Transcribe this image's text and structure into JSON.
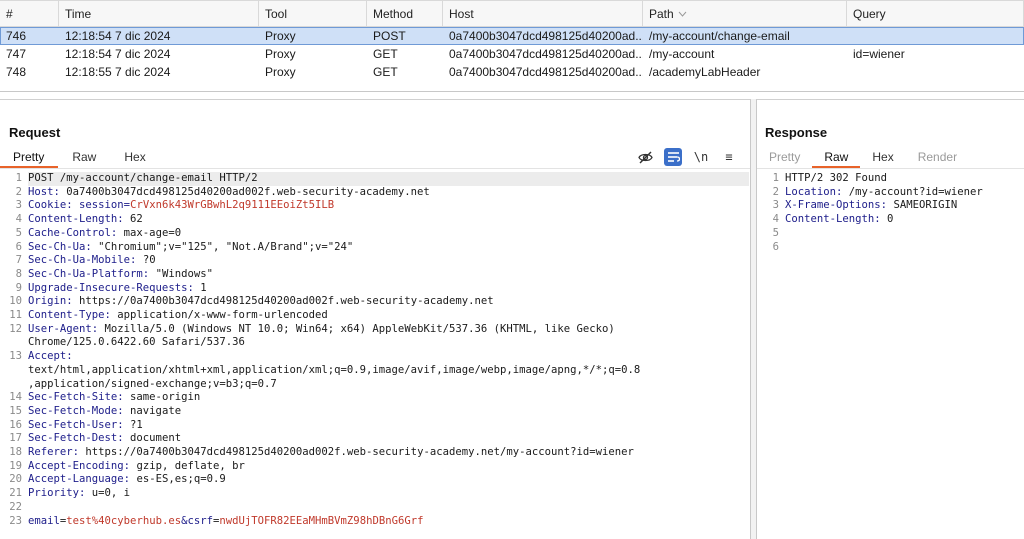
{
  "history": {
    "columns": [
      "#",
      "Time",
      "Tool",
      "Method",
      "Host",
      "Path",
      "Query"
    ],
    "rows": [
      {
        "num": "746",
        "time": "12:18:54 7 dic 2024",
        "tool": "Proxy",
        "method": "POST",
        "host": "0a7400b3047dcd498125d40200ad...",
        "path": "/my-account/change-email",
        "query": ""
      },
      {
        "num": "747",
        "time": "12:18:54 7 dic 2024",
        "tool": "Proxy",
        "method": "GET",
        "host": "0a7400b3047dcd498125d40200ad...",
        "path": "/my-account",
        "query": "id=wiener"
      },
      {
        "num": "748",
        "time": "12:18:55 7 dic 2024",
        "tool": "Proxy",
        "method": "GET",
        "host": "0a7400b3047dcd498125d40200ad...",
        "path": "/academyLabHeader",
        "query": ""
      }
    ]
  },
  "request": {
    "title": "Request",
    "tabs": [
      "Pretty",
      "Raw",
      "Hex"
    ],
    "toolbar": {
      "wrap": "\\n",
      "menu": "≡"
    },
    "lines": [
      {
        "n": "1",
        "plain": "POST /my-account/change-email HTTP/2"
      },
      {
        "n": "2",
        "key": "Host:",
        "val": " 0a7400b3047dcd498125d40200ad002f.web-security-academy.net"
      },
      {
        "n": "3",
        "key": "Cookie:",
        "cname": " session=",
        "cval": "CrVxn6k43WrGBwhL2q9111EEoiZt5ILB"
      },
      {
        "n": "4",
        "key": "Content-Length:",
        "val": " 62"
      },
      {
        "n": "5",
        "key": "Cache-Control:",
        "val": " max-age=0"
      },
      {
        "n": "6",
        "key": "Sec-Ch-Ua:",
        "val": " \"Chromium\";v=\"125\", \"Not.A/Brand\";v=\"24\""
      },
      {
        "n": "7",
        "key": "Sec-Ch-Ua-Mobile:",
        "val": " ?0"
      },
      {
        "n": "8",
        "key": "Sec-Ch-Ua-Platform:",
        "val": " \"Windows\""
      },
      {
        "n": "9",
        "key": "Upgrade-Insecure-Requests:",
        "val": " 1"
      },
      {
        "n": "10",
        "key": "Origin:",
        "val": " https://0a7400b3047dcd498125d40200ad002f.web-security-academy.net"
      },
      {
        "n": "11",
        "key": "Content-Type:",
        "val": " application/x-www-form-urlencoded"
      },
      {
        "n": "12",
        "key": "User-Agent:",
        "val": " Mozilla/5.0 (Windows NT 10.0; Win64; x64) AppleWebKit/537.36 (KHTML, like Gecko)"
      },
      {
        "n": "",
        "val": "Chrome/125.0.6422.60 Safari/537.36"
      },
      {
        "n": "13",
        "key": "Accept:",
        "val": ""
      },
      {
        "n": "",
        "val": "text/html,application/xhtml+xml,application/xml;q=0.9,image/avif,image/webp,image/apng,*/*;q=0.8"
      },
      {
        "n": "",
        "val": ",application/signed-exchange;v=b3;q=0.7"
      },
      {
        "n": "14",
        "key": "Sec-Fetch-Site:",
        "val": " same-origin"
      },
      {
        "n": "15",
        "key": "Sec-Fetch-Mode:",
        "val": " navigate"
      },
      {
        "n": "16",
        "key": "Sec-Fetch-User:",
        "val": " ?1"
      },
      {
        "n": "17",
        "key": "Sec-Fetch-Dest:",
        "val": " document"
      },
      {
        "n": "18",
        "key": "Referer:",
        "val": " https://0a7400b3047dcd498125d40200ad002f.web-security-academy.net/my-account?id=wiener"
      },
      {
        "n": "19",
        "key": "Accept-Encoding:",
        "val": " gzip, deflate, br"
      },
      {
        "n": "20",
        "key": "Accept-Language:",
        "val": " es-ES,es;q=0.9"
      },
      {
        "n": "21",
        "key": "Priority:",
        "val": " u=0, i"
      },
      {
        "n": "22",
        "val": ""
      },
      {
        "n": "23",
        "body": [
          {
            "p": "email",
            "v": "test%40cyberhub.es"
          },
          {
            "p": "&csrf",
            "v": "nwdUjTOFR82EEaMHmBVmZ98hDBnG6Grf"
          }
        ]
      }
    ]
  },
  "response": {
    "title": "Response",
    "tabs": [
      "Pretty",
      "Raw",
      "Hex",
      "Render"
    ],
    "lines": [
      {
        "n": "1",
        "plain": "HTTP/2 302 Found"
      },
      {
        "n": "2",
        "key": "Location:",
        "val": " /my-account?id=wiener"
      },
      {
        "n": "3",
        "key": "X-Frame-Options:",
        "val": " SAMEORIGIN"
      },
      {
        "n": "4",
        "key": "Content-Length:",
        "val": " 0"
      },
      {
        "n": "5",
        "val": ""
      },
      {
        "n": "6",
        "val": ""
      }
    ]
  },
  "colors": {
    "accent": "#e8632a",
    "selection": "#cfe0f7",
    "header_key": "#1d1d8a",
    "value_red": "#c0392b",
    "toggle_on": "#3b6fc9"
  }
}
